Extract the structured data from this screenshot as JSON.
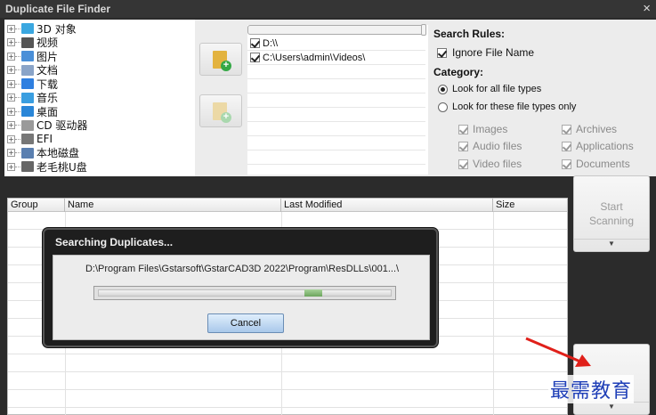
{
  "window": {
    "title": "Duplicate File Finder",
    "close_glyph": "×"
  },
  "tree": {
    "items": [
      {
        "label": "3D 对象",
        "icon": "3d-objects-icon",
        "color": "#3aa7e0"
      },
      {
        "label": "视频",
        "icon": "videos-icon",
        "color": "#555555"
      },
      {
        "label": "图片",
        "icon": "pictures-icon",
        "color": "#4a8fd8"
      },
      {
        "label": "文档",
        "icon": "documents-icon",
        "color": "#8aa4c8"
      },
      {
        "label": "下载",
        "icon": "downloads-icon",
        "color": "#2f7fe0"
      },
      {
        "label": "音乐",
        "icon": "music-icon",
        "color": "#3a9ee0"
      },
      {
        "label": "桌面",
        "icon": "desktop-icon",
        "color": "#2a86d8"
      },
      {
        "label": "CD 驱动器",
        "icon": "cd-drive-icon",
        "color": "#9a9a9a"
      },
      {
        "label": "EFI",
        "icon": "drive-icon",
        "color": "#777777"
      },
      {
        "label": "本地磁盘",
        "icon": "local-disk-icon",
        "color": "#5a7fb0"
      },
      {
        "label": "老毛桃U盘",
        "icon": "usb-drive-icon",
        "color": "#666666"
      }
    ]
  },
  "folders": {
    "add_button": {
      "icon": "add-folder-icon"
    },
    "remove_button": {
      "icon": "remove-folder-icon"
    },
    "items": [
      {
        "path": "D:\\\\",
        "checked": true
      },
      {
        "path": "C:\\Users\\admin\\Videos\\",
        "checked": true
      }
    ]
  },
  "rules": {
    "search_rules_heading": "Search Rules:",
    "ignore_file_name": {
      "label": "Ignore File Name",
      "checked": true
    },
    "category_heading": "Category:",
    "look_all": {
      "label": "Look for all file types",
      "selected": true
    },
    "look_these": {
      "label": "Look for these file types only",
      "selected": false
    },
    "types": [
      {
        "label": "Images",
        "checked": true
      },
      {
        "label": "Archives",
        "checked": true
      },
      {
        "label": "Audio files",
        "checked": true
      },
      {
        "label": "Applications",
        "checked": true
      },
      {
        "label": "Video files",
        "checked": true
      },
      {
        "label": "Documents",
        "checked": true
      }
    ]
  },
  "table": {
    "columns": [
      "Group",
      "Name",
      "Last Modified",
      "Size"
    ]
  },
  "scan_button": {
    "line1": "Start",
    "line2": "Scanning",
    "dropdown_glyph": "▼"
  },
  "stop_button": {
    "dropdown_glyph": "▼"
  },
  "dialog": {
    "title": "Searching Duplicates...",
    "current_path": "D:\\Program Files\\Gstarsoft\\GstarCAD3D 2022\\Program\\ResDLLs\\001...\\",
    "progress": {
      "start_fraction": 0.7,
      "end_fraction": 0.76,
      "color": "#7fb36e"
    },
    "cancel_label": "Cancel"
  },
  "watermark": {
    "text": "最需教育"
  },
  "colors": {
    "arrow": "#e0201a",
    "watermark": "#1f3fb7"
  }
}
